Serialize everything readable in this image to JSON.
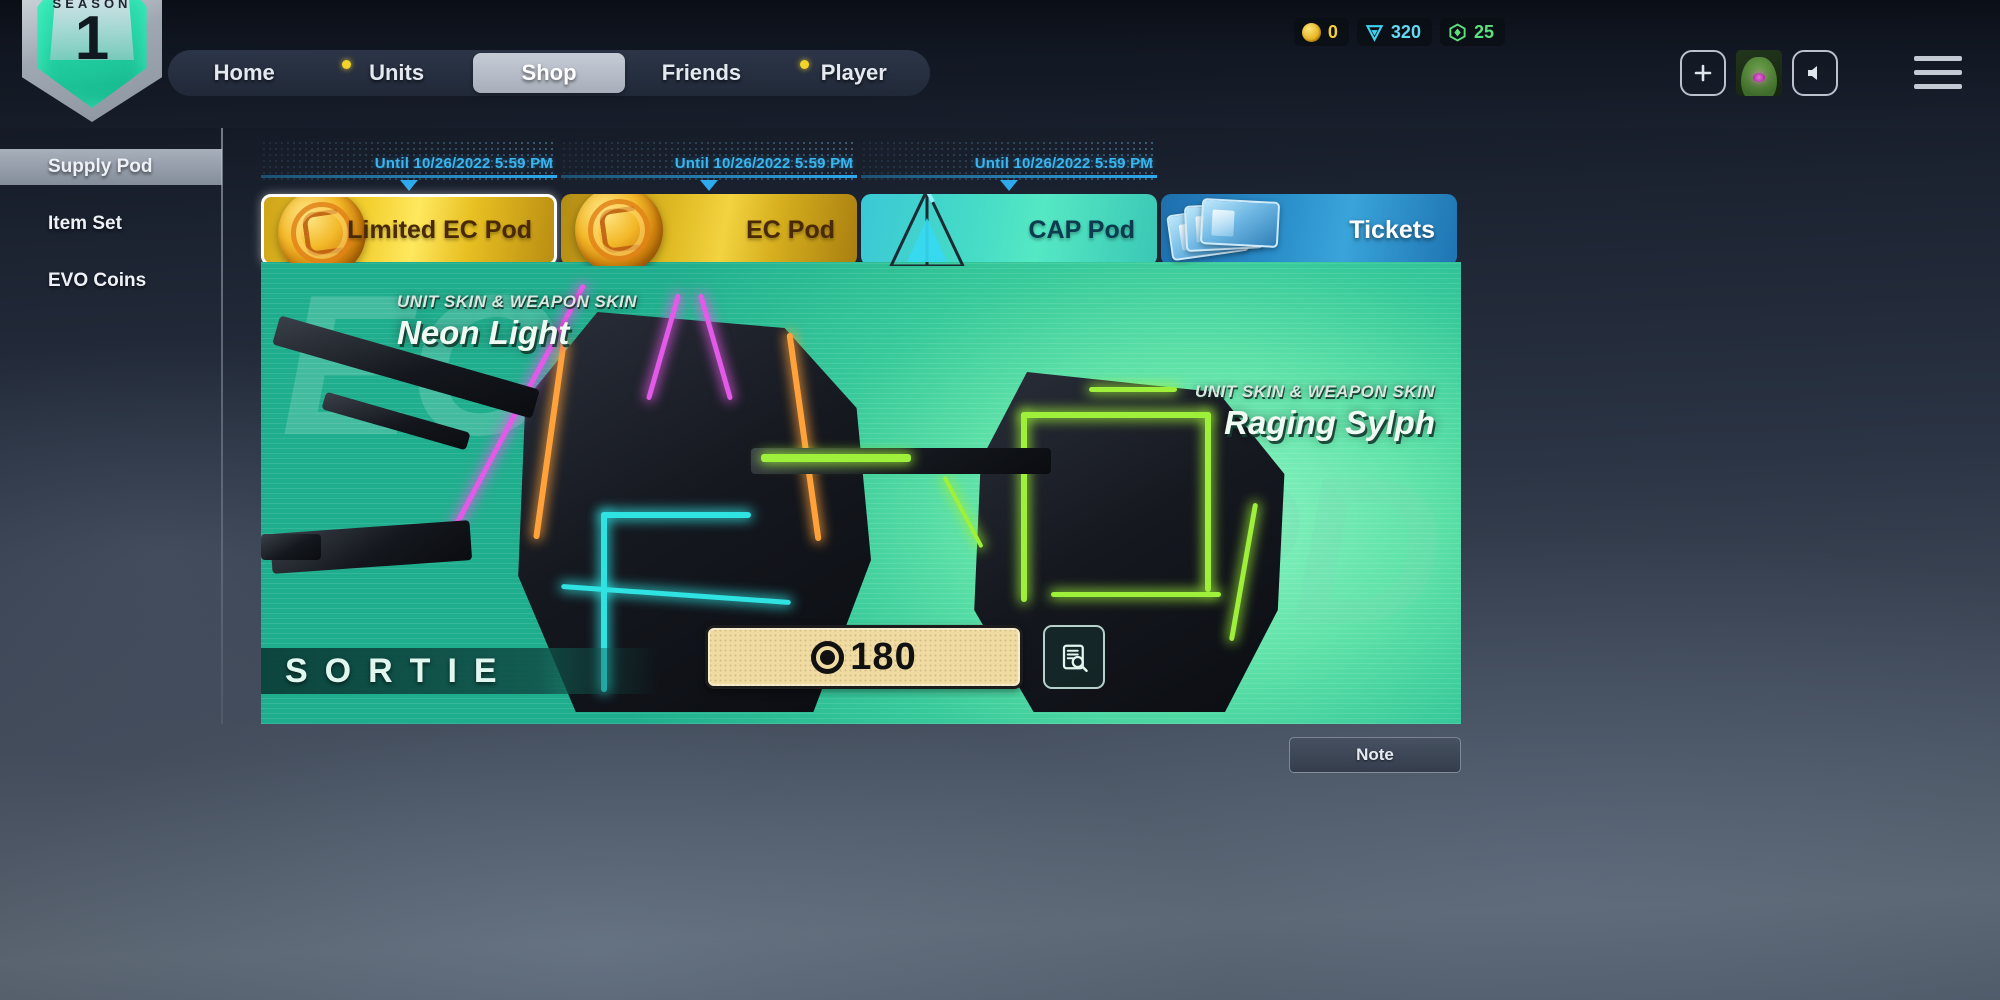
{
  "season": {
    "label": "SEASON",
    "number": "1"
  },
  "nav": {
    "items": [
      {
        "label": "Home",
        "active": false,
        "badge": false
      },
      {
        "label": "Units",
        "active": false,
        "badge": true
      },
      {
        "label": "Shop",
        "active": true,
        "badge": false
      },
      {
        "label": "Friends",
        "active": false,
        "badge": false
      },
      {
        "label": "Player",
        "active": false,
        "badge": true
      }
    ]
  },
  "currencies": [
    {
      "name": "gold-coin",
      "value": "0",
      "color": "#f4cf3d"
    },
    {
      "name": "ec-crystal",
      "value": "320",
      "color": "#63d9f2"
    },
    {
      "name": "evo-coin",
      "value": "25",
      "color": "#5de07e"
    }
  ],
  "actions": {
    "add": "+",
    "avatar": "player-avatar",
    "sound": "sound-icon",
    "menu": "menu-icon"
  },
  "sidebar": {
    "items": [
      {
        "label": "Supply Pod",
        "active": true
      },
      {
        "label": "Item Set",
        "active": false
      },
      {
        "label": "EVO Coins",
        "active": false
      }
    ]
  },
  "pod_tabs": [
    {
      "label": "Limited EC Pod",
      "date": "Until 10/26/2022 5:59 PM",
      "active": true,
      "style": "gold",
      "art": "ec-coin"
    },
    {
      "label": "EC Pod",
      "date": "Until 10/26/2022 5:59 PM",
      "active": false,
      "style": "gold-dim",
      "art": "ec-coin"
    },
    {
      "label": "CAP Pod",
      "date": "Until 10/26/2022 5:59 PM",
      "active": false,
      "style": "cyan",
      "art": "cap-prism"
    },
    {
      "label": "Tickets",
      "date": "",
      "active": false,
      "style": "blue",
      "art": "ticket-cards"
    }
  ],
  "banner": {
    "ghost_left": "EC",
    "ghost_right": "PD",
    "skins": [
      {
        "kind": "UNIT SKIN & WEAPON SKIN",
        "name": "Neon Light",
        "align": "left"
      },
      {
        "kind": "UNIT SKIN & WEAPON SKIN",
        "name": "Raging Sylph",
        "align": "right"
      }
    ],
    "sortie_label": "SORTIE",
    "price": "180",
    "price_icon": "ec-token-icon",
    "detail_icon": "magnify-list-icon"
  },
  "footer": {
    "note_label": "Note"
  }
}
